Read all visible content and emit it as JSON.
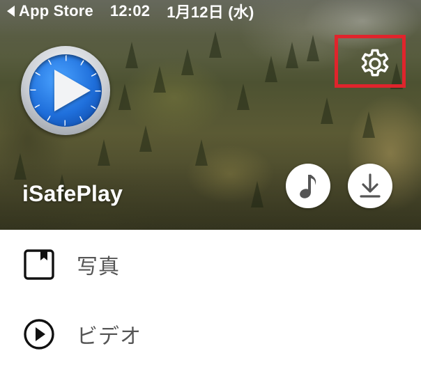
{
  "status_bar": {
    "back_label": "App Store",
    "time": "12:02",
    "date": "1月12日 (水)"
  },
  "header": {
    "app_name": "iSafePlay",
    "settings_icon": "gear-icon",
    "music_icon": "music-note-icon",
    "download_icon": "download-icon",
    "highlight_color": "#e0242c"
  },
  "menu": {
    "items": [
      {
        "label": "写真",
        "icon": "photo-book-icon"
      },
      {
        "label": "ビデオ",
        "icon": "play-circle-icon"
      }
    ]
  }
}
